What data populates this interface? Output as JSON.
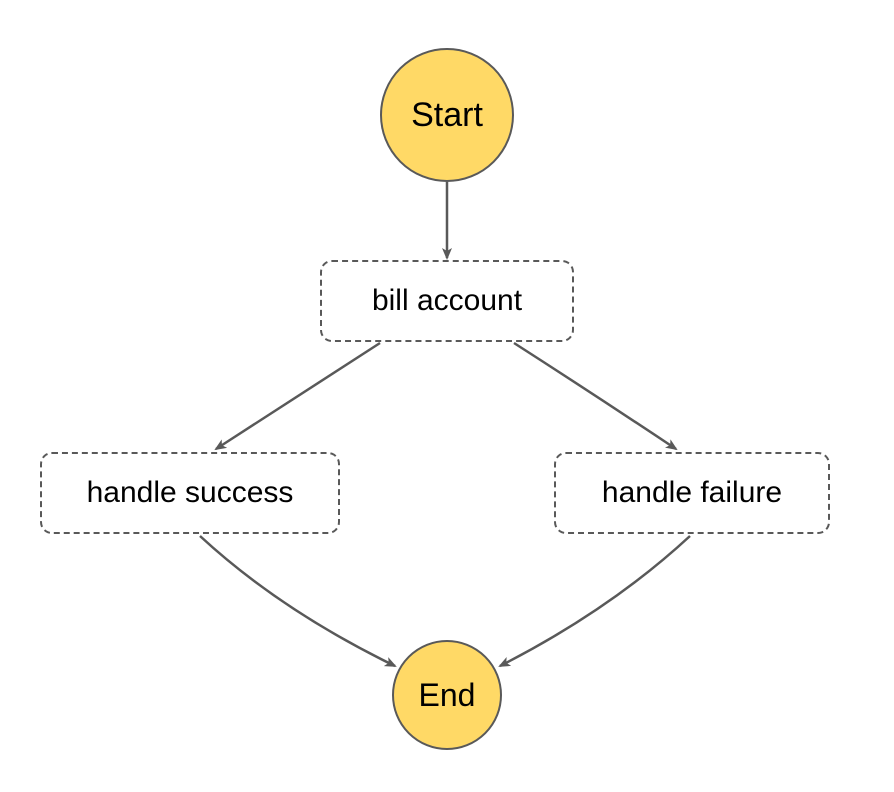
{
  "nodes": {
    "start": {
      "label": "Start"
    },
    "bill_account": {
      "label": "bill account"
    },
    "handle_success": {
      "label": "handle success"
    },
    "handle_failure": {
      "label": "handle failure"
    },
    "end": {
      "label": "End"
    }
  },
  "colors": {
    "circle_fill": "#ffd966",
    "border": "#595959",
    "arrow": "#595959"
  },
  "edges": [
    {
      "from": "start",
      "to": "bill_account"
    },
    {
      "from": "bill_account",
      "to": "handle_success"
    },
    {
      "from": "bill_account",
      "to": "handle_failure"
    },
    {
      "from": "handle_success",
      "to": "end"
    },
    {
      "from": "handle_failure",
      "to": "end"
    }
  ]
}
